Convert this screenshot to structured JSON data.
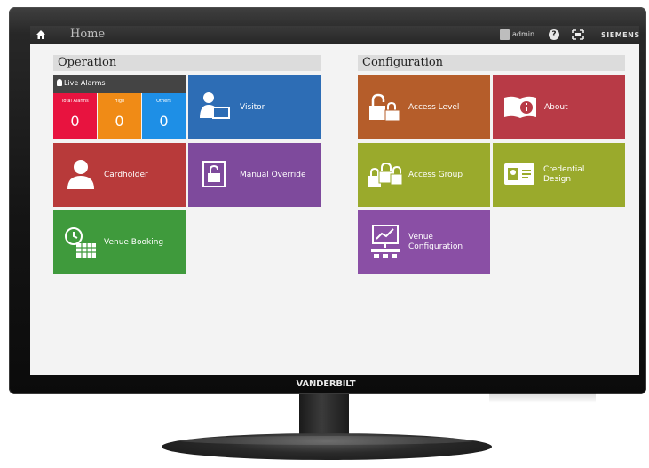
{
  "topbar": {
    "title": "Home",
    "user": "admin",
    "help_symbol": "?",
    "brand": "SIEMENS"
  },
  "icons": {
    "home": "home-icon",
    "user": "user-icon",
    "help": "help-icon",
    "fullscreen": "fullscreen-icon"
  },
  "operation": {
    "heading": "Operation",
    "live_alarms": {
      "title": "Live Alarms",
      "boxes": [
        {
          "label": "Total Alarms",
          "value": "0",
          "color": "#e8133f"
        },
        {
          "label": "High",
          "value": "0",
          "color": "#f08b16"
        },
        {
          "label": "Others",
          "value": "0",
          "color": "#1e8fe6"
        }
      ]
    },
    "tiles": {
      "visitor": {
        "label": "Visitor",
        "color": "#2d6db5"
      },
      "cardholder": {
        "label": "Cardholder",
        "color": "#b83a3a"
      },
      "manual_override": {
        "label": "Manual Override",
        "color": "#7e4a9c"
      },
      "venue_booking": {
        "label": "Venue Booking",
        "color": "#3f9a3c"
      }
    }
  },
  "configuration": {
    "heading": "Configuration",
    "tiles": {
      "access_level": {
        "label": "Access Level",
        "color": "#b55d2a"
      },
      "about": {
        "label": "About",
        "color": "#b83a46"
      },
      "access_group": {
        "label": "Access Group",
        "color": "#9aaa2c"
      },
      "credential_design": {
        "label_line1": "Credential",
        "label_line2": "Design",
        "color": "#9aaa2c"
      },
      "venue_configuration": {
        "label_line1": "Venue",
        "label_line2": "Configuration",
        "color": "#8a4fa5"
      }
    }
  },
  "monitor": {
    "logo": "VANDERBILT"
  }
}
